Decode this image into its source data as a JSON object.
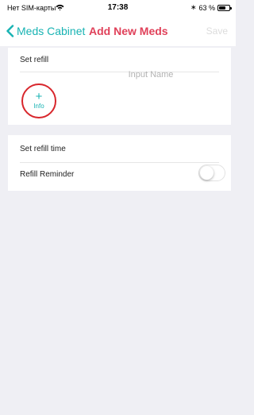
{
  "status_bar": {
    "carrier": "Нет SIM-карты",
    "time": "17:38",
    "battery": "63 %",
    "battery_level": 0.63,
    "bluetooth_symbol": "∗",
    "icons": [
      "wifi-icon",
      "bluetooth-icon",
      "battery-icon"
    ]
  },
  "nav": {
    "back_label": "Meds Cabinet",
    "title": "Add New Meds",
    "save_label": "Save"
  },
  "refill_card": {
    "label": "Set refill",
    "info_symbol": "+",
    "info_label": "Info",
    "name_input": {
      "value": "",
      "placeholder": "Input Name"
    }
  },
  "time_card": {
    "refill_time_label": "Set refill time",
    "reminder_label": "Refill Reminder",
    "reminder_on": false
  },
  "colors": {
    "accent": "#18b3b3",
    "title": "#e0415a",
    "highlight_ring": "#d8262c",
    "background": "#efeff4"
  }
}
